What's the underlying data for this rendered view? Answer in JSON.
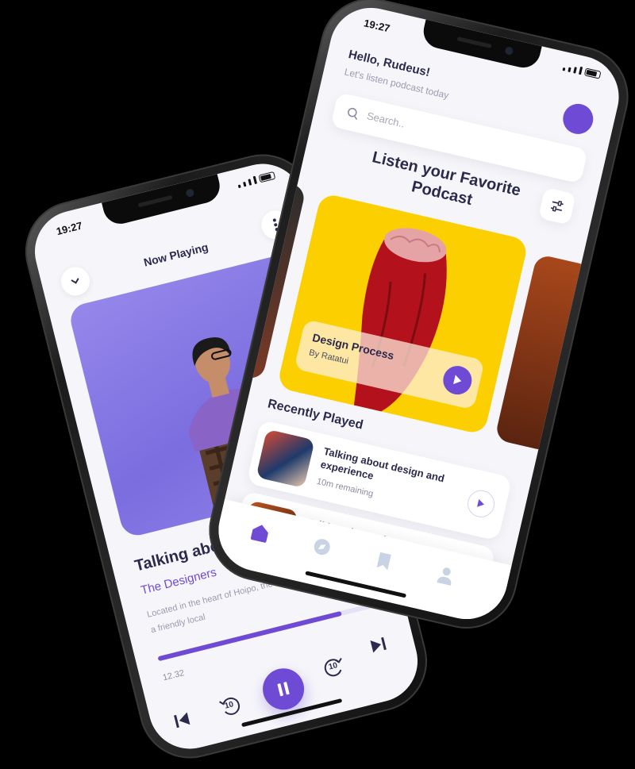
{
  "now_playing_phone": {
    "status": {
      "time": "19:27"
    },
    "header": {
      "title": "Now Playing"
    },
    "track": {
      "title": "Talking about design",
      "artist": "The Designers",
      "description": "Located in the heart of Hoipo, the Designers Hotel is proudly a friendly local"
    },
    "progress": {
      "current": "12.32",
      "fraction": 0.82
    },
    "controls": {
      "rewind_label": "10",
      "forward_label": "10"
    }
  },
  "home_phone": {
    "status": {
      "time": "19:27"
    },
    "greeting": {
      "title": "Hello, Rudeus!",
      "subtitle": "Let's listen podcast today"
    },
    "search": {
      "placeholder": "Search.."
    },
    "hero_title": "Listen your Favorite Podcast",
    "featured": {
      "title": "Design Process",
      "author": "By Ratatui"
    },
    "recent": {
      "heading": "Recently Played",
      "items": [
        {
          "title": "Talking about design and experience",
          "meta": "10m remaining"
        },
        {
          "title": "Talking about why Responsive important",
          "meta": ""
        }
      ]
    }
  },
  "colors": {
    "accent": "#6f4ad4",
    "yellow": "#fcd000",
    "background": "#f6f6fa"
  }
}
